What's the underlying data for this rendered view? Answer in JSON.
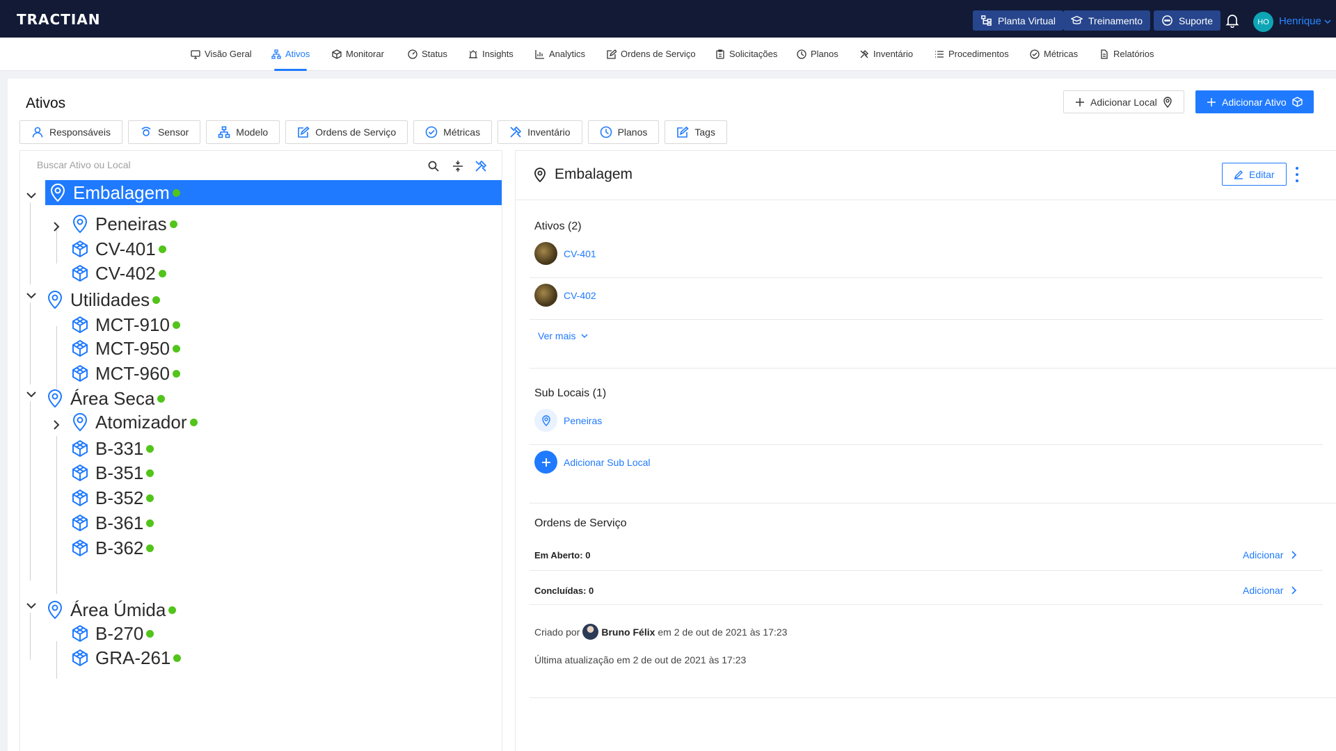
{
  "topbar": {
    "logo": "TRACTIAN",
    "buttons": [
      {
        "label": "Planta Virtual",
        "icon": "network-icon"
      },
      {
        "label": "Treinamento",
        "icon": "graduation-cap-icon"
      },
      {
        "label": "Suporte",
        "icon": "chat-icon"
      }
    ],
    "notification_icon": "bell-icon",
    "user_initials": "HO",
    "user_name": "Henrique"
  },
  "nav": {
    "items": [
      {
        "label": "Visão Geral",
        "icon": "monitor-icon"
      },
      {
        "label": "Ativos",
        "icon": "hierarchy-icon",
        "active": true
      },
      {
        "label": "Monitorar",
        "icon": "cube-icon"
      },
      {
        "label": "Status",
        "icon": "gauge-icon"
      },
      {
        "label": "Insights",
        "icon": "alarm-icon"
      },
      {
        "label": "Analytics",
        "icon": "bar-chart-icon"
      },
      {
        "label": "Ordens de Serviço",
        "icon": "edit-icon"
      },
      {
        "label": "Solicitações",
        "icon": "clipboard-icon"
      },
      {
        "label": "Planos",
        "icon": "clock-icon"
      },
      {
        "label": "Inventário",
        "icon": "tools-icon"
      },
      {
        "label": "Procedimentos",
        "icon": "list-icon"
      },
      {
        "label": "Métricas",
        "icon": "check-gauge-icon"
      },
      {
        "label": "Relatórios",
        "icon": "document-icon"
      }
    ]
  },
  "page": {
    "title": "Ativos",
    "add_location_label": "Adicionar Local",
    "add_asset_label": "Adicionar Ativo",
    "filters": [
      {
        "label": "Responsáveis",
        "icon": "user-icon"
      },
      {
        "label": "Sensor",
        "icon": "sensor-icon"
      },
      {
        "label": "Modelo",
        "icon": "model-icon"
      },
      {
        "label": "Ordens de Serviço",
        "icon": "edit-icon"
      },
      {
        "label": "Métricas",
        "icon": "check-gauge-icon"
      },
      {
        "label": "Inventário",
        "icon": "tools-icon"
      },
      {
        "label": "Planos",
        "icon": "clock-icon"
      },
      {
        "label": "Tags",
        "icon": "edit-icon"
      }
    ]
  },
  "tree": {
    "search_placeholder": "Buscar Ativo ou Local",
    "nodes": [
      {
        "label": "Embalagem",
        "type": "location",
        "status": "online",
        "selected": true
      },
      {
        "label": "Peneiras",
        "type": "location",
        "status": "online"
      },
      {
        "label": "CV-401",
        "type": "asset",
        "status": "online"
      },
      {
        "label": "CV-402",
        "type": "asset",
        "status": "online"
      },
      {
        "label": "Utilidades",
        "type": "location",
        "status": "online"
      },
      {
        "label": "MCT-910",
        "type": "asset",
        "status": "online"
      },
      {
        "label": "MCT-950",
        "type": "asset",
        "status": "online"
      },
      {
        "label": "MCT-960",
        "type": "asset",
        "status": "online"
      },
      {
        "label": "Área Seca",
        "type": "location",
        "status": "online"
      },
      {
        "label": "Atomizador",
        "type": "location",
        "status": "online"
      },
      {
        "label": "B-331",
        "type": "asset",
        "status": "online"
      },
      {
        "label": "B-351",
        "type": "asset",
        "status": "online"
      },
      {
        "label": "B-352",
        "type": "asset",
        "status": "online"
      },
      {
        "label": "B-361",
        "type": "asset",
        "status": "online"
      },
      {
        "label": "B-362",
        "type": "asset",
        "status": "online"
      },
      {
        "label": "Área Úmida",
        "type": "location",
        "status": "online"
      },
      {
        "label": "B-270",
        "type": "asset",
        "status": "online"
      },
      {
        "label": "GRA-261",
        "type": "asset",
        "status": "online"
      }
    ]
  },
  "detail": {
    "title": "Embalagem",
    "edit_label": "Editar",
    "assets_title": "Ativos (2)",
    "assets": [
      "CV-401",
      "CV-402"
    ],
    "see_more": "Ver mais",
    "sublocations_title": "Sub Locais (1)",
    "sublocations": [
      "Peneiras"
    ],
    "add_sublocation": "Adicionar Sub Local",
    "work_orders_title": "Ordens de Serviço",
    "open_label": "Em Aberto: 0",
    "done_label": "Concluídas: 0",
    "add_label": "Adicionar",
    "created_prefix": "Criado por",
    "created_by": "Bruno Félix",
    "created_suffix": "em 2 de out de 2021 às 17:23",
    "updated": "Última atualização em 2 de out de 2021 às 17:23"
  },
  "colors": {
    "topbar": "#121a36",
    "primary": "#1f7aff",
    "status_online": "#52c41a"
  }
}
